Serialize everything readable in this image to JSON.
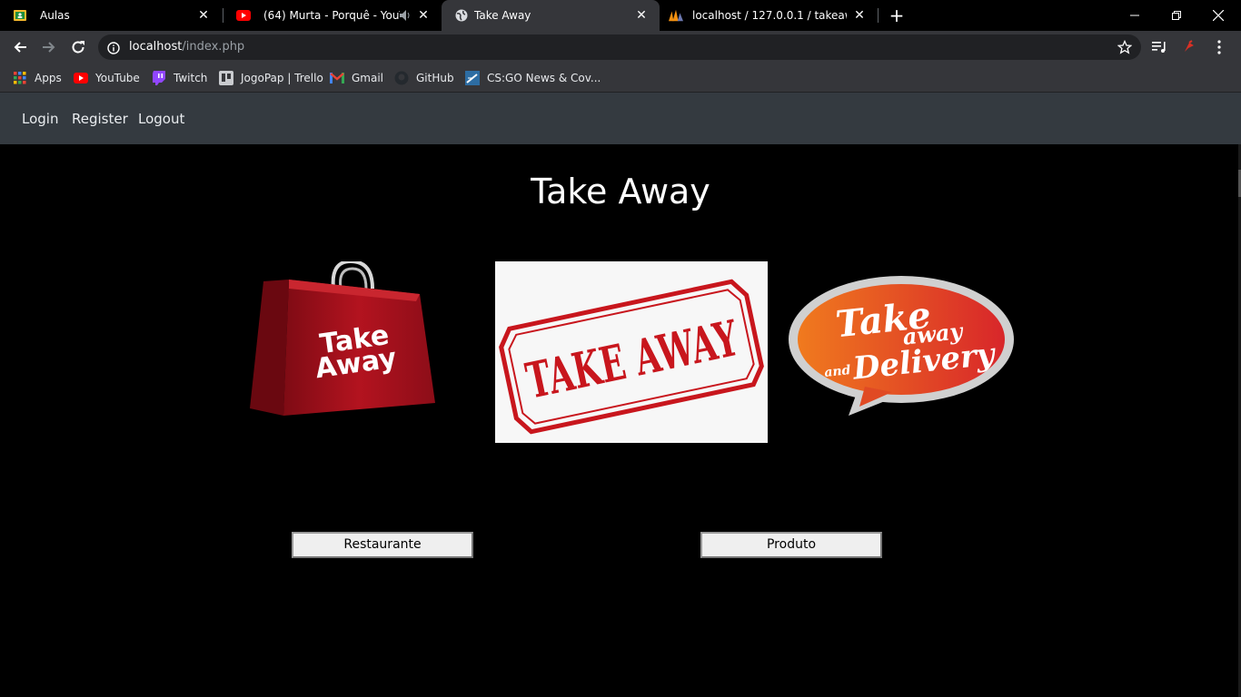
{
  "browser": {
    "tabs": [
      {
        "title": "Aulas",
        "icon": "classroom-icon"
      },
      {
        "title": "(64) Murta - Porquê - YouTube",
        "icon": "youtube-icon"
      },
      {
        "title": "Take Away",
        "icon": "globe-icon",
        "active": true
      },
      {
        "title": "localhost / 127.0.0.1 / takeaway / ...",
        "icon": "phpmyadmin-icon"
      }
    ],
    "url_host": "localhost",
    "url_path": "/index.php",
    "bookmarks": [
      {
        "label": "Apps",
        "icon": "apps-grid-icon"
      },
      {
        "label": "YouTube",
        "icon": "youtube-icon"
      },
      {
        "label": "Twitch",
        "icon": "twitch-icon"
      },
      {
        "label": "JogoPap | Trello",
        "icon": "trello-icon"
      },
      {
        "label": "Gmail",
        "icon": "gmail-icon"
      },
      {
        "label": "GitHub",
        "icon": "github-icon"
      },
      {
        "label": "CS:GO News & Cov...",
        "icon": "hltv-icon"
      }
    ]
  },
  "site": {
    "nav": {
      "login": "Login",
      "register": "Register",
      "logout": "Logout"
    },
    "title": "Take Away",
    "images": {
      "bag_line1": "Take",
      "bag_line2": "Away",
      "stamp_text": "TAKE AWAY",
      "bubble_line1": "Take",
      "bubble_line2": "away",
      "bubble_and": "and",
      "bubble_line3": "Delivery"
    },
    "buttons": {
      "restaurante": "Restaurante",
      "produto": "Produto"
    }
  },
  "colors": {
    "navbar_bg": "#343a40",
    "page_bg": "#000000",
    "bag_red": "#a3101d",
    "stamp_red": "#c8161d",
    "bubble_orange": "#f07a1e",
    "bubble_red": "#d8262a"
  }
}
